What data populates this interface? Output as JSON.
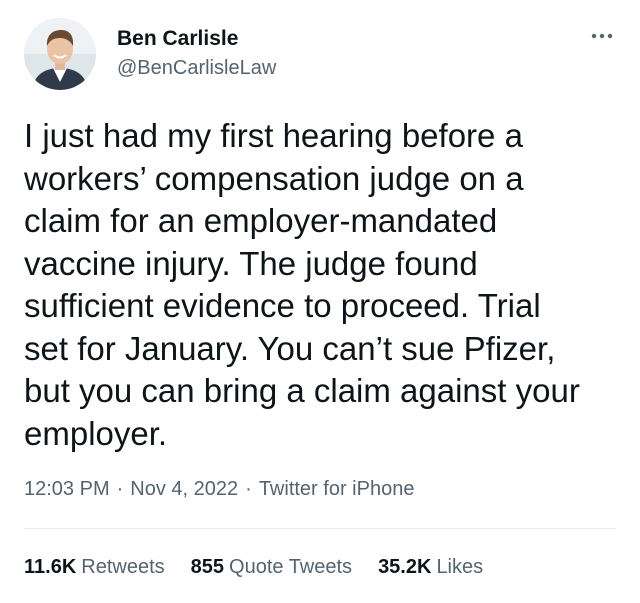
{
  "author": {
    "name": "Ben Carlisle",
    "handle": "@BenCarlisleLaw"
  },
  "tweet": {
    "text": "I just had my first hearing before a\nworkers’ compensation judge on a\nclaim for an employer-mandated\nvaccine injury. The judge found\nsufficient evidence to proceed. Trial\nset for January. You can’t sue Pfizer,\nbut you can bring a claim against your\nemployer."
  },
  "meta": {
    "time": "12:03 PM",
    "separator": "·",
    "date": "Nov 4, 2022",
    "source": "Twitter for iPhone"
  },
  "stats": {
    "retweets": {
      "count": "11.6K",
      "label": "Retweets"
    },
    "quote_tweets": {
      "count": "855",
      "label": "Quote Tweets"
    },
    "likes": {
      "count": "35.2K",
      "label": "Likes"
    }
  },
  "icons": {
    "more": "more-horizontal-icon",
    "avatar": "profile-photo"
  },
  "colors": {
    "text": "#0f1419",
    "secondary": "#536471",
    "divider": "#e6ecf0"
  }
}
